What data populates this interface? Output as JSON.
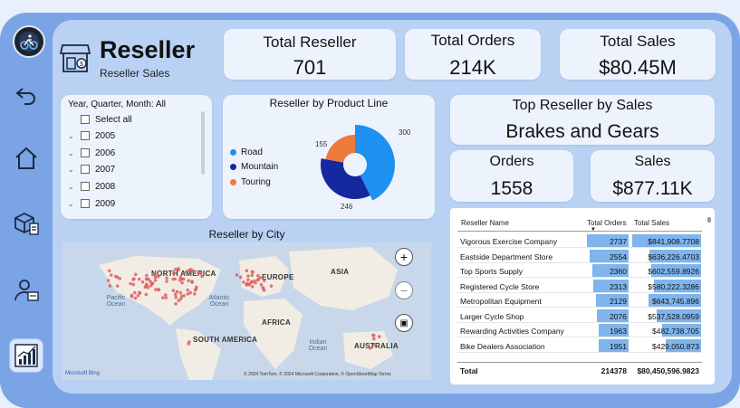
{
  "header": {
    "title": "Reseller",
    "subtitle": "Reseller Sales"
  },
  "kpis": [
    {
      "label": "Total Reseller",
      "value": "701"
    },
    {
      "label": "Total Orders",
      "value": "214K"
    },
    {
      "label": "Total Sales",
      "value": "$80.45M"
    }
  ],
  "top_reseller": {
    "label": "Top Reseller by Sales",
    "value": "Brakes and Gears"
  },
  "top_kpis": [
    {
      "label": "Orders",
      "value": "1558"
    },
    {
      "label": "Sales",
      "value": "$877.11K"
    }
  ],
  "slicer": {
    "title": "Year, Quarter, Month: All",
    "items": [
      "Select all",
      "2005",
      "2006",
      "2007",
      "2008",
      "2009"
    ]
  },
  "donut": {
    "title": "Reseller by Product Line",
    "legend": [
      "Road",
      "Mountain",
      "Touring"
    ],
    "labels": [
      "300",
      "246",
      "155"
    ],
    "colors": [
      "#1e90f0",
      "#1528a0",
      "#ee7a3a"
    ]
  },
  "chart_data": {
    "type": "pie",
    "title": "Reseller by Product Line",
    "categories": [
      "Road",
      "Mountain",
      "Touring"
    ],
    "values": [
      300,
      246,
      155
    ]
  },
  "map": {
    "title": "Reseller by City",
    "labels": {
      "north_america": "NORTH AMERICA",
      "europe": "EUROPE",
      "asia": "ASIA",
      "africa": "AFRICA",
      "south_america": "SOUTH AMERICA",
      "australia": "AUSTRALIA",
      "pacific": "Pacific Ocean",
      "atlantic": "Atlantic Ocean",
      "indian": "Indian Ocean"
    },
    "attribution": "© 2024 TomTom, © 2024 Microsoft Corporation, © OpenStreetMap  Terms",
    "brand": "Microsoft Bing"
  },
  "table": {
    "headers": [
      "Reseller Name",
      "Total Orders",
      "Total Sales"
    ],
    "rows": [
      {
        "name": "Vigorous Exercise Company",
        "orders": "2737",
        "sales": "$841,908.7708",
        "f1": 1.0,
        "f2": 1.0
      },
      {
        "name": "Eastside Department Store",
        "orders": "2554",
        "sales": "$636,226.4703",
        "f1": 0.93,
        "f2": 0.75
      },
      {
        "name": "Top Sports Supply",
        "orders": "2360",
        "sales": "$602,559.8926",
        "f1": 0.86,
        "f2": 0.72
      },
      {
        "name": "Registered Cycle Store",
        "orders": "2313",
        "sales": "$580,222.3286",
        "f1": 0.85,
        "f2": 0.69
      },
      {
        "name": "Metropolitan Equipment",
        "orders": "2129",
        "sales": "$643,745.896",
        "f1": 0.78,
        "f2": 0.76
      },
      {
        "name": "Larger Cycle Shop",
        "orders": "2076",
        "sales": "$537,528.0959",
        "f1": 0.76,
        "f2": 0.64
      },
      {
        "name": "Rewarding Activities Company",
        "orders": "1963",
        "sales": "$482,738.705",
        "f1": 0.72,
        "f2": 0.57
      },
      {
        "name": "Bike Dealers Association",
        "orders": "1951",
        "sales": "$429,050.873",
        "f1": 0.71,
        "f2": 0.51
      }
    ],
    "total": {
      "label": "Total",
      "orders": "214378",
      "sales": "$80,450,596.9823"
    }
  }
}
